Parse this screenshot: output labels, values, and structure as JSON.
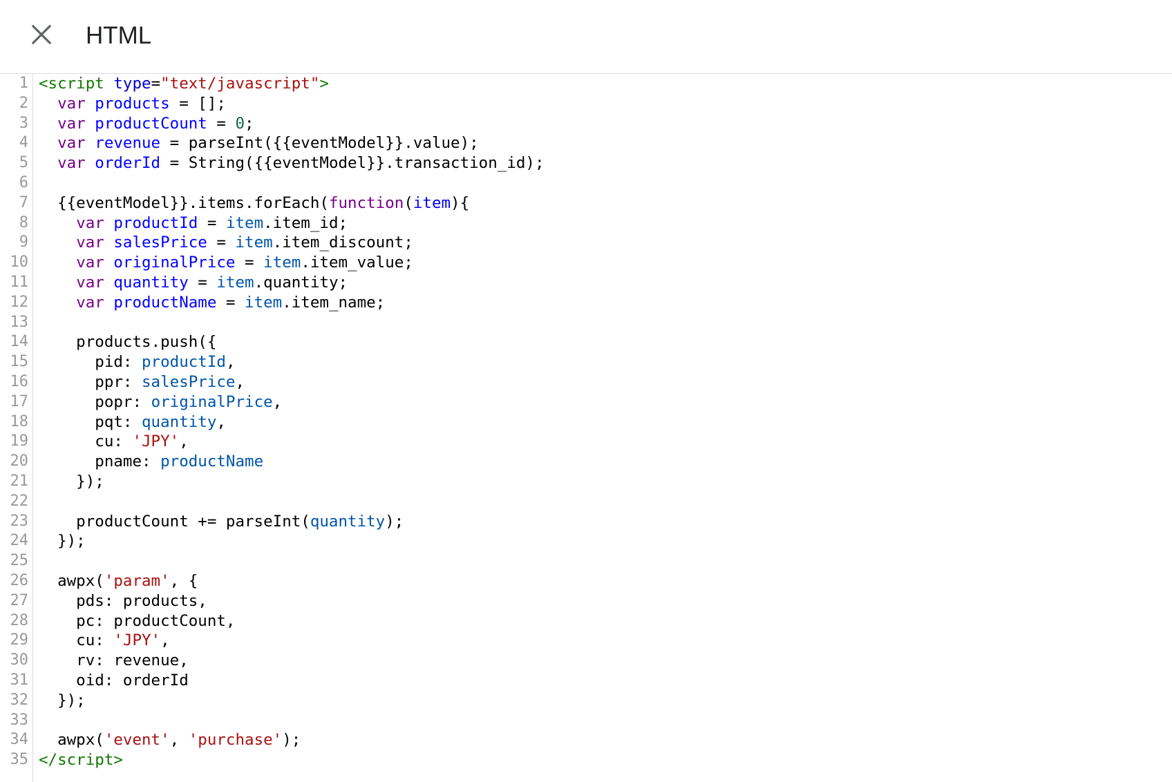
{
  "header": {
    "title": "HTML",
    "close_icon": "close-icon"
  },
  "editor": {
    "language": "HTML",
    "colors": {
      "tag": "#117700",
      "attribute": "#0000cc",
      "string": "#aa1111",
      "keyword": "#770088",
      "definition": "#0000ff",
      "variable": "#0055aa",
      "number": "#116644",
      "line_number": "#999999"
    },
    "lines": [
      [
        {
          "t": "<script",
          "c": "tag"
        },
        {
          "t": " "
        },
        {
          "t": "type",
          "c": "attr"
        },
        {
          "t": "="
        },
        {
          "t": "\"text/javascript\"",
          "c": "str"
        },
        {
          "t": ">",
          "c": "tag"
        }
      ],
      [
        {
          "t": "  "
        },
        {
          "t": "var",
          "c": "kw"
        },
        {
          "t": " "
        },
        {
          "t": "products",
          "c": "def"
        },
        {
          "t": " = [];"
        }
      ],
      [
        {
          "t": "  "
        },
        {
          "t": "var",
          "c": "kw"
        },
        {
          "t": " "
        },
        {
          "t": "productCount",
          "c": "def"
        },
        {
          "t": " = "
        },
        {
          "t": "0",
          "c": "num"
        },
        {
          "t": ";"
        }
      ],
      [
        {
          "t": "  "
        },
        {
          "t": "var",
          "c": "kw"
        },
        {
          "t": " "
        },
        {
          "t": "revenue",
          "c": "def"
        },
        {
          "t": " = parseInt({{eventModel}}.value);"
        }
      ],
      [
        {
          "t": "  "
        },
        {
          "t": "var",
          "c": "kw"
        },
        {
          "t": " "
        },
        {
          "t": "orderId",
          "c": "def"
        },
        {
          "t": " = String({{eventModel}}.transaction_id);"
        }
      ],
      [],
      [
        {
          "t": "  {{eventModel}}.items.forEach("
        },
        {
          "t": "function",
          "c": "kw"
        },
        {
          "t": "("
        },
        {
          "t": "item",
          "c": "def"
        },
        {
          "t": "){"
        }
      ],
      [
        {
          "t": "    "
        },
        {
          "t": "var",
          "c": "kw"
        },
        {
          "t": " "
        },
        {
          "t": "productId",
          "c": "def"
        },
        {
          "t": " = "
        },
        {
          "t": "item",
          "c": "var2"
        },
        {
          "t": ".item_id;"
        }
      ],
      [
        {
          "t": "    "
        },
        {
          "t": "var",
          "c": "kw"
        },
        {
          "t": " "
        },
        {
          "t": "salesPrice",
          "c": "def"
        },
        {
          "t": " = "
        },
        {
          "t": "item",
          "c": "var2"
        },
        {
          "t": ".item_discount;"
        }
      ],
      [
        {
          "t": "    "
        },
        {
          "t": "var",
          "c": "kw"
        },
        {
          "t": " "
        },
        {
          "t": "originalPrice",
          "c": "def"
        },
        {
          "t": " = "
        },
        {
          "t": "item",
          "c": "var2"
        },
        {
          "t": ".item_value;"
        }
      ],
      [
        {
          "t": "    "
        },
        {
          "t": "var",
          "c": "kw"
        },
        {
          "t": " "
        },
        {
          "t": "quantity",
          "c": "def"
        },
        {
          "t": " = "
        },
        {
          "t": "item",
          "c": "var2"
        },
        {
          "t": ".quantity;"
        }
      ],
      [
        {
          "t": "    "
        },
        {
          "t": "var",
          "c": "kw"
        },
        {
          "t": " "
        },
        {
          "t": "productName",
          "c": "def"
        },
        {
          "t": " = "
        },
        {
          "t": "item",
          "c": "var2"
        },
        {
          "t": ".item_name;"
        }
      ],
      [],
      [
        {
          "t": "    products.push({"
        }
      ],
      [
        {
          "t": "      pid: "
        },
        {
          "t": "productId",
          "c": "var2"
        },
        {
          "t": ","
        }
      ],
      [
        {
          "t": "      ppr: "
        },
        {
          "t": "salesPrice",
          "c": "var2"
        },
        {
          "t": ","
        }
      ],
      [
        {
          "t": "      popr: "
        },
        {
          "t": "originalPrice",
          "c": "var2"
        },
        {
          "t": ","
        }
      ],
      [
        {
          "t": "      pqt: "
        },
        {
          "t": "quantity",
          "c": "var2"
        },
        {
          "t": ","
        }
      ],
      [
        {
          "t": "      cu: "
        },
        {
          "t": "'JPY'",
          "c": "str"
        },
        {
          "t": ","
        }
      ],
      [
        {
          "t": "      pname: "
        },
        {
          "t": "productName",
          "c": "var2"
        }
      ],
      [
        {
          "t": "    });"
        }
      ],
      [],
      [
        {
          "t": "    productCount += parseInt("
        },
        {
          "t": "quantity",
          "c": "var2"
        },
        {
          "t": ");"
        }
      ],
      [
        {
          "t": "  });"
        }
      ],
      [],
      [
        {
          "t": "  awpx("
        },
        {
          "t": "'param'",
          "c": "str"
        },
        {
          "t": ", {"
        }
      ],
      [
        {
          "t": "    pds: products,"
        }
      ],
      [
        {
          "t": "    pc: productCount,"
        }
      ],
      [
        {
          "t": "    cu: "
        },
        {
          "t": "'JPY'",
          "c": "str"
        },
        {
          "t": ","
        }
      ],
      [
        {
          "t": "    rv: revenue,"
        }
      ],
      [
        {
          "t": "    oid: orderId"
        }
      ],
      [
        {
          "t": "  });"
        }
      ],
      [],
      [
        {
          "t": "  awpx("
        },
        {
          "t": "'event'",
          "c": "str"
        },
        {
          "t": ", "
        },
        {
          "t": "'purchase'",
          "c": "str"
        },
        {
          "t": ");"
        }
      ],
      [
        {
          "t": "</script",
          "c": "tag"
        },
        {
          "t": ">",
          "c": "tag"
        }
      ]
    ]
  }
}
